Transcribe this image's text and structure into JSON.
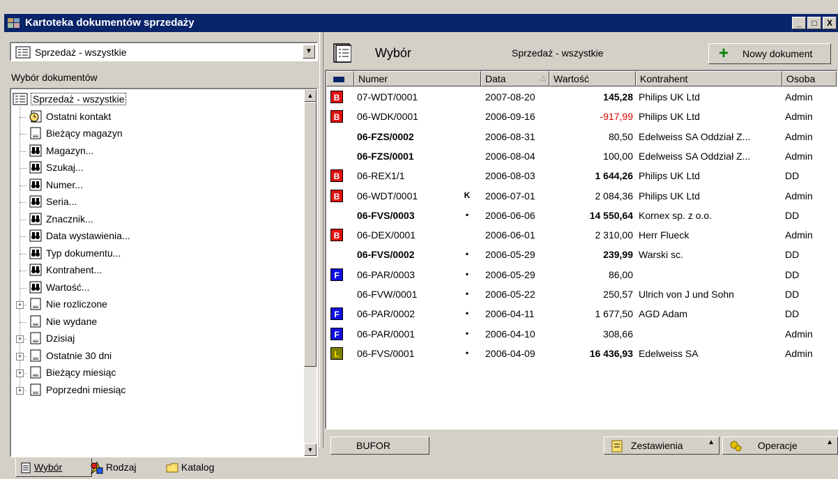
{
  "window": {
    "title": "Kartoteka dokumentów sprzedaży",
    "controls": [
      "_",
      "□",
      "X"
    ]
  },
  "left": {
    "combo_value": "Sprzedaż - wszystkie",
    "section_label": "Wybór dokumentów",
    "tree": [
      {
        "label": "Sprzedaż - wszystkie",
        "icon": "document-list-icon",
        "level": 0,
        "selected": true
      },
      {
        "label": "Ostatni kontakt",
        "icon": "clock-icon",
        "level": 1
      },
      {
        "label": "Bieżący magazyn",
        "icon": "document-icon",
        "level": 1
      },
      {
        "label": "Magazyn...",
        "icon": "binoculars-icon",
        "level": 1
      },
      {
        "label": "Szukaj...",
        "icon": "binoculars-icon",
        "level": 1
      },
      {
        "label": "Numer...",
        "icon": "binoculars-icon",
        "level": 1
      },
      {
        "label": "Seria...",
        "icon": "binoculars-icon",
        "level": 1
      },
      {
        "label": "Znacznik...",
        "icon": "binoculars-icon",
        "level": 1
      },
      {
        "label": "Data wystawienia...",
        "icon": "binoculars-icon",
        "level": 1
      },
      {
        "label": "Typ dokumentu...",
        "icon": "binoculars-icon",
        "level": 1
      },
      {
        "label": "Kontrahent...",
        "icon": "binoculars-icon",
        "level": 1
      },
      {
        "label": "Wartość...",
        "icon": "binoculars-icon",
        "level": 1
      },
      {
        "label": "Nie rozliczone",
        "icon": "document-icon",
        "level": 1,
        "expandable": true
      },
      {
        "label": "Nie wydane",
        "icon": "document-icon",
        "level": 1
      },
      {
        "label": "Dzisiaj",
        "icon": "document-icon",
        "level": 1,
        "expandable": true
      },
      {
        "label": "Ostatnie 30 dni",
        "icon": "document-icon",
        "level": 1,
        "expandable": true
      },
      {
        "label": "Bieżący miesiąc",
        "icon": "document-icon",
        "level": 1,
        "expandable": true
      },
      {
        "label": "Poprzedni miesiąc",
        "icon": "document-icon",
        "level": 1,
        "expandable": true
      }
    ],
    "tabs": [
      {
        "label": "Wybór",
        "icon": "document-icon",
        "active": true
      },
      {
        "label": "Rodzaj",
        "icon": "shapes-icon",
        "active": false
      },
      {
        "label": "Katalog",
        "icon": "folder-icon",
        "active": false
      }
    ]
  },
  "right": {
    "header_title": "Wybór",
    "header_subtitle": "Sprzedaż - wszystkie",
    "new_doc_label": "Nowy dokument",
    "columns": [
      "Numer",
      "Data",
      "Wartość",
      "Kontrahent",
      "Osoba"
    ],
    "rows": [
      {
        "badge": "B",
        "badge_color": "#e01010",
        "numer": "07-WDT/0001",
        "flag": "",
        "data": "2007-08-20",
        "wartosc": "145,28",
        "wartosc_bold": true,
        "wartosc_color": "#000000",
        "kontrahent": "Philips UK Ltd",
        "osoba": "Admin",
        "bold": false
      },
      {
        "badge": "B",
        "badge_color": "#e01010",
        "numer": "06-WDK/0001",
        "flag": "",
        "data": "2006-09-16",
        "wartosc": "-917,99",
        "wartosc_bold": false,
        "wartosc_color": "#e00000",
        "kontrahent": "Philips UK Ltd",
        "osoba": "Admin",
        "bold": false
      },
      {
        "badge": "",
        "badge_color": "",
        "numer": "06-FZS/0002",
        "flag": "",
        "data": "2006-08-31",
        "wartosc": "80,50",
        "wartosc_bold": false,
        "wartosc_color": "#000000",
        "kontrahent": "Edelweiss SA Oddział Z...",
        "osoba": "Admin",
        "bold": true
      },
      {
        "badge": "",
        "badge_color": "",
        "numer": "06-FZS/0001",
        "flag": "",
        "data": "2006-08-04",
        "wartosc": "100,00",
        "wartosc_bold": false,
        "wartosc_color": "#000000",
        "kontrahent": "Edelweiss SA Oddział Z...",
        "osoba": "Admin",
        "bold": true
      },
      {
        "badge": "B",
        "badge_color": "#e01010",
        "numer": "06-REX1/1",
        "flag": "",
        "data": "2006-08-03",
        "wartosc": "1 644,26",
        "wartosc_bold": true,
        "wartosc_color": "#000000",
        "kontrahent": "Philips UK Ltd",
        "osoba": "DD",
        "bold": false
      },
      {
        "badge": "B",
        "badge_color": "#e01010",
        "numer": "06-WDT/0001",
        "flag": "K",
        "data": "2006-07-01",
        "wartosc": "2 084,36",
        "wartosc_bold": false,
        "wartosc_color": "#000000",
        "kontrahent": "Philips UK Ltd",
        "osoba": "Admin",
        "bold": false
      },
      {
        "badge": "",
        "badge_color": "",
        "numer": "06-FVS/0003",
        "flag": "•",
        "data": "2006-06-06",
        "wartosc": "14 550,64",
        "wartosc_bold": true,
        "wartosc_color": "#000000",
        "kontrahent": "Kornex sp. z o.o.",
        "osoba": "DD",
        "bold": true
      },
      {
        "badge": "B",
        "badge_color": "#e01010",
        "numer": "06-DEX/0001",
        "flag": "",
        "data": "2006-06-01",
        "wartosc": "2 310,00",
        "wartosc_bold": false,
        "wartosc_color": "#000000",
        "kontrahent": "Herr Flueck",
        "osoba": "Admin",
        "bold": false
      },
      {
        "badge": "",
        "badge_color": "",
        "numer": "06-FVS/0002",
        "flag": "•",
        "data": "2006-05-29",
        "wartosc": "239,99",
        "wartosc_bold": true,
        "wartosc_color": "#000000",
        "kontrahent": "Warski sc.",
        "osoba": "DD",
        "bold": true
      },
      {
        "badge": "F",
        "badge_color": "#1010e0",
        "numer": "06-PAR/0003",
        "flag": "•",
        "data": "2006-05-29",
        "wartosc": "86,00",
        "wartosc_bold": false,
        "wartosc_color": "#000000",
        "kontrahent": "",
        "osoba": "DD",
        "bold": false
      },
      {
        "badge": "",
        "badge_color": "",
        "numer": "06-FVW/0001",
        "flag": "•",
        "data": "2006-05-22",
        "wartosc": "250,57",
        "wartosc_bold": false,
        "wartosc_color": "#000000",
        "kontrahent": "Ulrich von J und Sohn",
        "osoba": "DD",
        "bold": false
      },
      {
        "badge": "F",
        "badge_color": "#1010e0",
        "numer": "06-PAR/0002",
        "flag": "•",
        "data": "2006-04-11",
        "wartosc": "1 677,50",
        "wartosc_bold": false,
        "wartosc_color": "#000000",
        "kontrahent": "AGD Adam",
        "osoba": "DD",
        "bold": false
      },
      {
        "badge": "F",
        "badge_color": "#1010e0",
        "numer": "06-PAR/0001",
        "flag": "•",
        "data": "2006-04-10",
        "wartosc": "308,66",
        "wartosc_bold": false,
        "wartosc_color": "#000000",
        "kontrahent": "",
        "osoba": "Admin",
        "bold": false
      },
      {
        "badge": "L",
        "badge_color": "#808000",
        "numer": "06-FVS/0001",
        "flag": "•",
        "data": "2006-04-09",
        "wartosc": "16 436,93",
        "wartosc_bold": true,
        "wartosc_color": "#000000",
        "kontrahent": "Edelweiss SA",
        "osoba": "Admin",
        "bold": false
      }
    ],
    "bufor_label": "BUFOR",
    "zestawienia_label": "Zestawienia",
    "operacje_label": "Operacje"
  }
}
